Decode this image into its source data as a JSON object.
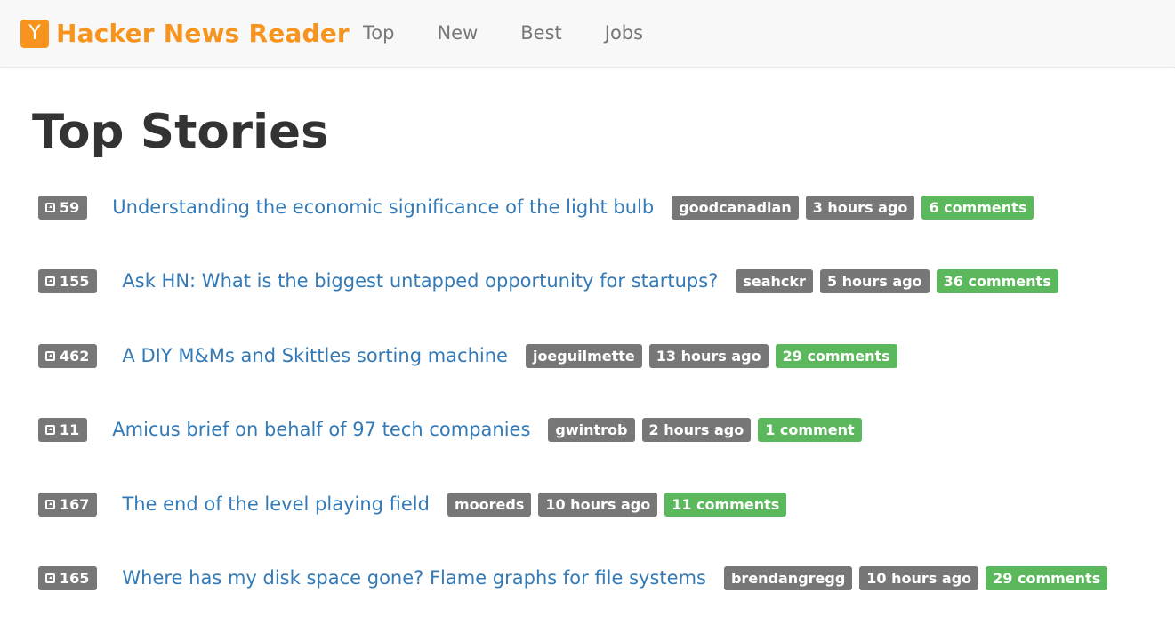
{
  "app": {
    "logo_letter": "Y",
    "brand": "Hacker News Reader",
    "brand_color": "#f7941e"
  },
  "nav": {
    "items": [
      {
        "label": "Top"
      },
      {
        "label": "New"
      },
      {
        "label": "Best"
      },
      {
        "label": "Jobs"
      }
    ]
  },
  "page": {
    "title": "Top Stories"
  },
  "stories": [
    {
      "score": "59",
      "title": "Understanding the economic significance of the light bulb",
      "author": "goodcanadian",
      "time": "3 hours ago",
      "comments": "6 comments"
    },
    {
      "score": "155",
      "title": "Ask HN: What is the biggest untapped opportunity for startups?",
      "author": "seahckr",
      "time": "5 hours ago",
      "comments": "36 comments"
    },
    {
      "score": "462",
      "title": "A DIY M&Ms and Skittles sorting machine",
      "author": "joeguilmette",
      "time": "13 hours ago",
      "comments": "29 comments"
    },
    {
      "score": "11",
      "title": "Amicus brief on behalf of 97 tech companies",
      "author": "gwintrob",
      "time": "2 hours ago",
      "comments": "1 comment"
    },
    {
      "score": "167",
      "title": "The end of the level playing field",
      "author": "mooreds",
      "time": "10 hours ago",
      "comments": "11 comments"
    },
    {
      "score": "165",
      "title": "Where has my disk space gone? Flame graphs for file systems",
      "author": "brendangregg",
      "time": "10 hours ago",
      "comments": "29 comments"
    }
  ],
  "colors": {
    "link": "#337ab7",
    "label_default": "#777777",
    "label_success": "#5cb85c"
  },
  "icons": {
    "score": "caret-square-up-icon"
  }
}
